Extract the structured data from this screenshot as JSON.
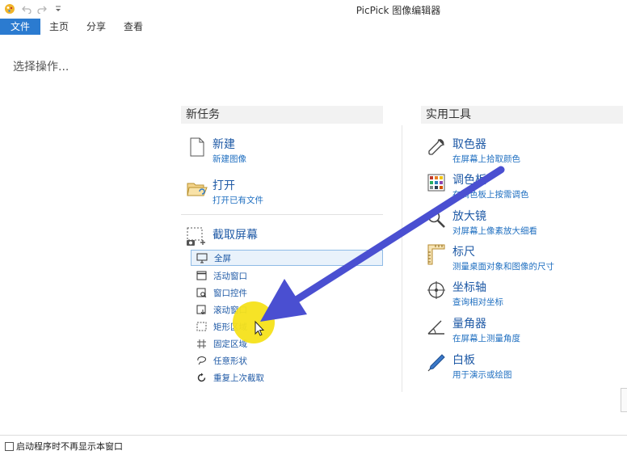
{
  "window": {
    "title": "PicPick 图像编辑器"
  },
  "tabs": [
    {
      "label": "文件",
      "active": true
    },
    {
      "label": "主页",
      "active": false
    },
    {
      "label": "分享",
      "active": false
    },
    {
      "label": "查看",
      "active": false
    }
  ],
  "prompt": "选择操作...",
  "new_task": {
    "header": "新任务",
    "items": [
      {
        "title": "新建",
        "sub": "新建图像",
        "icon": "blank-document-icon"
      },
      {
        "title": "打开",
        "sub": "打开已有文件",
        "icon": "open-folder-icon"
      }
    ],
    "capture": {
      "title": "截取屏幕",
      "icon": "screen-capture-icon",
      "options": [
        {
          "label": "全屏",
          "icon": "monitor-icon",
          "selected": true
        },
        {
          "label": "活动窗口",
          "icon": "window-icon",
          "selected": false
        },
        {
          "label": "窗口控件",
          "icon": "window-control-icon",
          "selected": false
        },
        {
          "label": "滚动窗口",
          "icon": "scroll-window-icon",
          "selected": false
        },
        {
          "label": "矩形区域",
          "icon": "rectangle-region-icon",
          "selected": false
        },
        {
          "label": "固定区域",
          "icon": "fixed-region-icon",
          "selected": false
        },
        {
          "label": "任意形状",
          "icon": "freehand-lasso-icon",
          "selected": false
        },
        {
          "label": "重复上次截取",
          "icon": "repeat-capture-icon",
          "selected": false
        }
      ]
    }
  },
  "tools": {
    "header": "实用工具",
    "items": [
      {
        "title": "取色器",
        "sub": "在屏幕上拾取颜色",
        "icon": "eyedropper-icon"
      },
      {
        "title": "调色板",
        "sub": "在调色板上按需调色",
        "icon": "color-palette-icon"
      },
      {
        "title": "放大镜",
        "sub": "对屏幕上像素放大细看",
        "icon": "magnifier-icon"
      },
      {
        "title": "标尺",
        "sub": "测量桌面对象和图像的尺寸",
        "icon": "ruler-icon"
      },
      {
        "title": "坐标轴",
        "sub": "查询相对坐标",
        "icon": "crosshair-icon"
      },
      {
        "title": "量角器",
        "sub": "在屏幕上测量角度",
        "icon": "protractor-icon"
      },
      {
        "title": "白板",
        "sub": "用于演示或绘图",
        "icon": "whiteboard-pen-icon"
      }
    ]
  },
  "footer": {
    "checkbox_label": "启动程序时不再显示本窗口",
    "checked": false
  },
  "colors": {
    "accent": "#2b7bd0",
    "link": "#1f5aa6",
    "annotation_arrow": "#4a4fd1",
    "cursor_highlight": "#f5e21a"
  }
}
